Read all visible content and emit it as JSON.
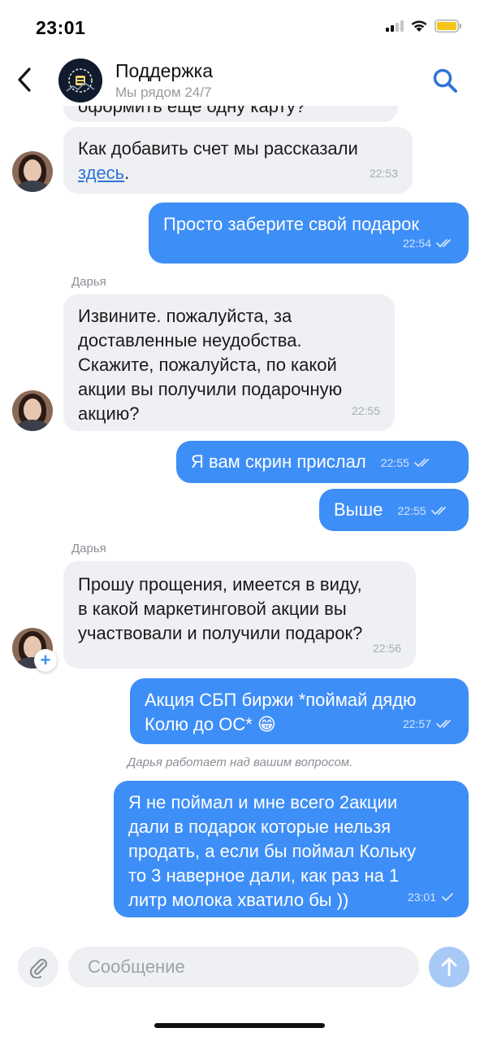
{
  "status_bar": {
    "time": "23:01"
  },
  "header": {
    "title": "Поддержка",
    "subtitle": "Мы рядом 24/7"
  },
  "messages": {
    "partial_top": {
      "text": "оформить ещё одну карту?"
    },
    "m1": {
      "text_before_link": "Как добавить счет мы рассказали ",
      "link": "здесь",
      "text_after_link": ".",
      "time": "22:53"
    },
    "m2": {
      "text": "Просто заберите свой подарок",
      "time": "22:54",
      "status": "read"
    },
    "sender1": "Дарья",
    "m3": {
      "lines": [
        "Извините. пожалуйста, за",
        "доставленные неудобства.",
        "Скажите, пожалуйста, по какой",
        "акции вы получили подарочную",
        "акцию?"
      ],
      "time": "22:55"
    },
    "m4": {
      "text": "Я вам скрин прислал",
      "time": "22:55",
      "status": "read"
    },
    "m5": {
      "text": "Выше",
      "time": "22:55",
      "status": "read"
    },
    "sender2": "Дарья",
    "m6": {
      "lines": [
        "Прошу прощения, имеется в виду,",
        "в какой маркетинговой акции вы",
        "участвовали и получили подарок?"
      ],
      "time": "22:56"
    },
    "m7": {
      "line1": "Акция СБП биржи *поймай дядю",
      "line2": "Колю до ОС* 😁",
      "time": "22:57",
      "status": "read"
    },
    "typing_status": "Дарья работает над вашим вопросом.",
    "m8": {
      "lines": [
        "Я не поймал и мне всего 2акции",
        "дали в подарок которые нельзя",
        "продать, а если бы поймал Кольку",
        "то 3 наверное дали, как раз на 1",
        "литр молока хватило бы ))"
      ],
      "time": "23:01",
      "status": "sent"
    }
  },
  "composer": {
    "placeholder": "Сообщение"
  },
  "icons": {
    "back": "chevron-left-icon",
    "search": "search-icon",
    "attach": "paperclip-icon",
    "send": "arrow-up-icon",
    "read": "double-check-icon",
    "sent": "single-check-icon"
  },
  "colors": {
    "outgoing_bubble": "#3e8ef7",
    "incoming_bubble": "#eef0f3",
    "accent": "#2d74d8",
    "send_button": "#a7c9f5",
    "battery": "#f5c518"
  }
}
